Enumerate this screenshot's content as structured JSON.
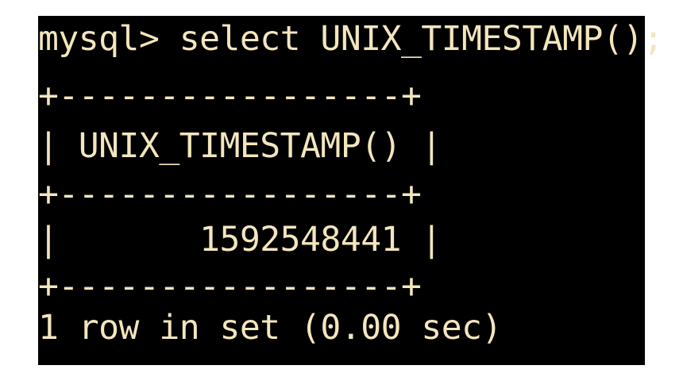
{
  "terminal": {
    "prompt": "mysql> ",
    "command": "select UNIX_TIMESTAMP();",
    "table": {
      "border": "+-----------------+",
      "header_row": "| UNIX_TIMESTAMP() |",
      "value_row": "|       1592548441 |"
    },
    "result_summary": "1 row in set (0.00 sec)"
  },
  "colors": {
    "background": "#000000",
    "text": "#f3e6bd"
  }
}
